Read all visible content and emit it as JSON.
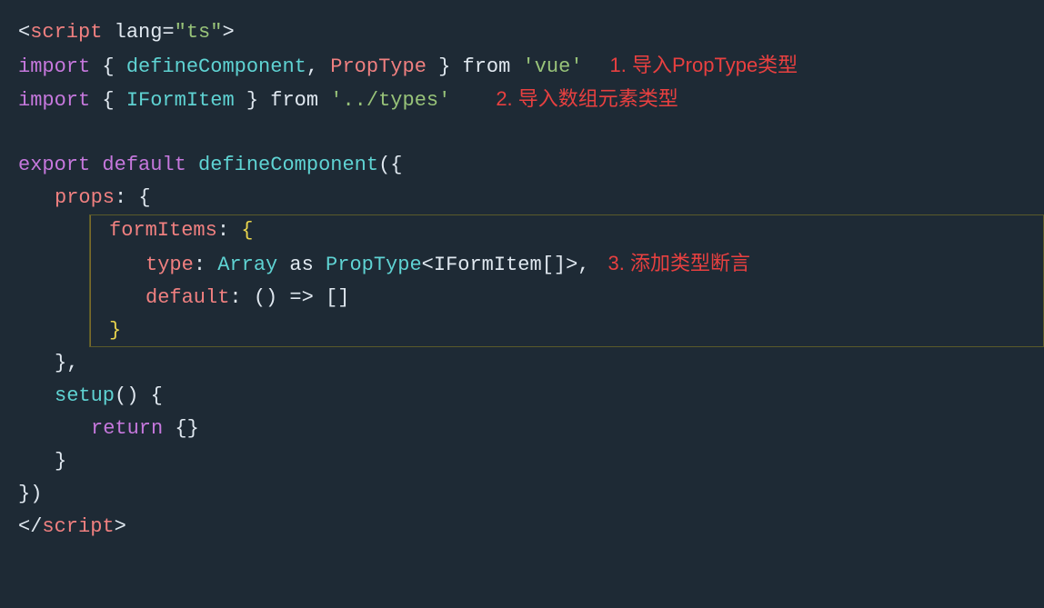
{
  "code": {
    "lines": [
      {
        "id": "line1",
        "indent": 0,
        "parts": [
          {
            "text": "<",
            "color": "white"
          },
          {
            "text": "script",
            "color": "pink"
          },
          {
            "text": " lang=",
            "color": "white"
          },
          {
            "text": "\"ts\"",
            "color": "string"
          },
          {
            "text": ">",
            "color": "white"
          }
        ],
        "annotation": null
      },
      {
        "id": "line2",
        "indent": 0,
        "parts": [
          {
            "text": "import",
            "color": "purple"
          },
          {
            "text": " { ",
            "color": "white"
          },
          {
            "text": "defineComponent",
            "color": "cyan"
          },
          {
            "text": ", ",
            "color": "white"
          },
          {
            "text": "PropType",
            "color": "pink"
          },
          {
            "text": " } ",
            "color": "white"
          },
          {
            "text": "from",
            "color": "white"
          },
          {
            "text": " 'vue'",
            "color": "string"
          }
        ],
        "annotation": "1. 导入PropType类型"
      },
      {
        "id": "line3",
        "indent": 0,
        "parts": [
          {
            "text": "import",
            "color": "purple"
          },
          {
            "text": " { ",
            "color": "white"
          },
          {
            "text": "IFormItem",
            "color": "cyan"
          },
          {
            "text": " } ",
            "color": "white"
          },
          {
            "text": "from",
            "color": "white"
          },
          {
            "text": " '../types'",
            "color": "string"
          }
        ],
        "annotation": "2. 导入数组元素类型"
      },
      {
        "id": "line4",
        "indent": 0,
        "parts": [],
        "annotation": null
      },
      {
        "id": "line5",
        "indent": 0,
        "parts": [
          {
            "text": "export",
            "color": "purple"
          },
          {
            "text": " ",
            "color": "white"
          },
          {
            "text": "default",
            "color": "purple"
          },
          {
            "text": " ",
            "color": "white"
          },
          {
            "text": "defineComponent",
            "color": "cyan"
          },
          {
            "text": "({",
            "color": "white"
          }
        ],
        "annotation": null
      },
      {
        "id": "line6",
        "indent": 1,
        "parts": [
          {
            "text": "props",
            "color": "pink"
          },
          {
            "text": ": {",
            "color": "white"
          }
        ],
        "annotation": null
      },
      {
        "id": "line7",
        "indent": 2,
        "parts": [
          {
            "text": "formItems",
            "color": "pink"
          },
          {
            "text": ": {",
            "color": "yellow"
          }
        ],
        "annotation": null
      },
      {
        "id": "line8",
        "indent": 3,
        "parts": [
          {
            "text": "type",
            "color": "pink"
          },
          {
            "text": ": ",
            "color": "white"
          },
          {
            "text": "Array",
            "color": "cyan"
          },
          {
            "text": " as ",
            "color": "white"
          },
          {
            "text": "PropType",
            "color": "cyan"
          },
          {
            "text": "<IFormItem[]>,",
            "color": "white"
          }
        ],
        "annotation": "3. 添加类型断言"
      },
      {
        "id": "line9",
        "indent": 3,
        "parts": [
          {
            "text": "default",
            "color": "pink"
          },
          {
            "text": ": () => []",
            "color": "white"
          }
        ],
        "annotation": null
      },
      {
        "id": "line10",
        "indent": 2,
        "parts": [
          {
            "text": "}",
            "color": "yellow"
          }
        ],
        "annotation": null
      },
      {
        "id": "line11",
        "indent": 1,
        "parts": [
          {
            "text": "},",
            "color": "white"
          }
        ],
        "annotation": null
      },
      {
        "id": "line12",
        "indent": 1,
        "parts": [
          {
            "text": "setup",
            "color": "cyan"
          },
          {
            "text": "() {",
            "color": "white"
          }
        ],
        "annotation": null
      },
      {
        "id": "line13",
        "indent": 2,
        "parts": [
          {
            "text": "return",
            "color": "purple"
          },
          {
            "text": " {}",
            "color": "white"
          }
        ],
        "annotation": null
      },
      {
        "id": "line14",
        "indent": 1,
        "parts": [
          {
            "text": "}",
            "color": "white"
          }
        ],
        "annotation": null
      },
      {
        "id": "line15",
        "indent": 0,
        "parts": [
          {
            "text": "})",
            "color": "white"
          }
        ],
        "annotation": null
      },
      {
        "id": "line16",
        "indent": 0,
        "parts": [
          {
            "text": "</",
            "color": "white"
          },
          {
            "text": "script",
            "color": "pink"
          },
          {
            "text": ">",
            "color": "white"
          }
        ],
        "annotation": null
      }
    ]
  }
}
